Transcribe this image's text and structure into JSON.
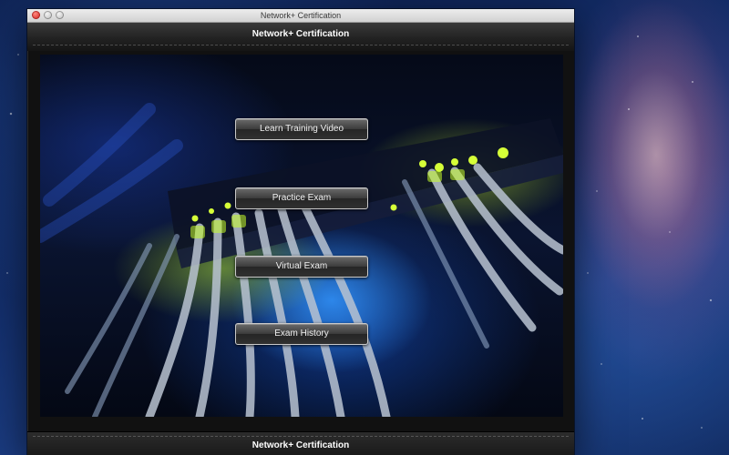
{
  "window": {
    "title": "Network+ Certification"
  },
  "header": {
    "title": "Network+ Certification"
  },
  "menu": {
    "buttons": [
      "Learn Training Video",
      "Practice Exam",
      "Virtual Exam",
      "Exam History"
    ]
  },
  "footer": {
    "title": "Network+ Certification"
  },
  "icons": {
    "close": "close-icon",
    "minimize": "minimize-icon",
    "zoom": "zoom-icon"
  },
  "colors": {
    "accent_green": "#c8ff2a",
    "accent_blue": "#2f8cff",
    "bar_dark": "#1a1a1a"
  }
}
